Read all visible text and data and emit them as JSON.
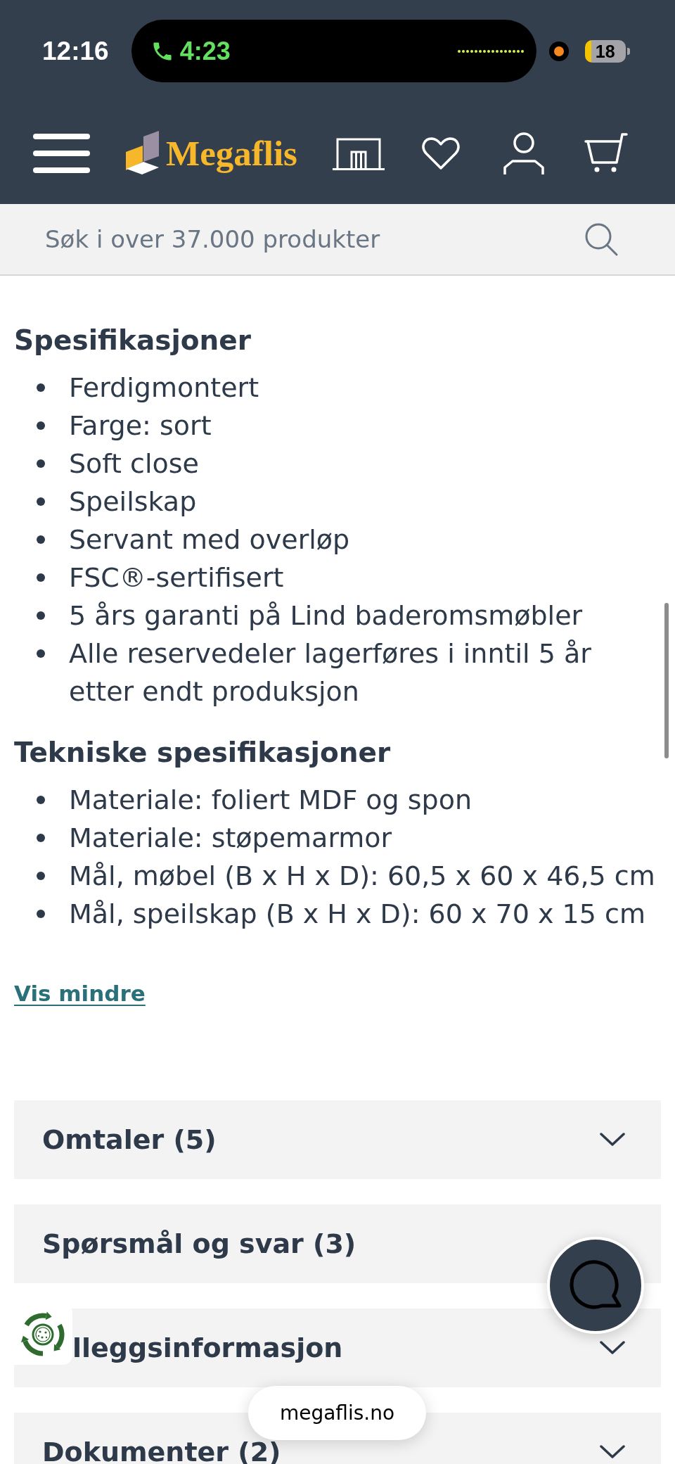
{
  "status_bar": {
    "time": "12:16",
    "call_timer": "4:23",
    "battery": "18"
  },
  "header": {
    "logo": "Megaflis"
  },
  "search": {
    "placeholder": "Søk i over 37.000 produkter"
  },
  "spec_groups": [
    {
      "title": "Spesifikasjoner",
      "items": [
        "Ferdigmontert",
        "Farge: sort",
        "Soft close",
        "Speilskap",
        "Servant med overløp",
        "FSC®-sertifisert",
        "5 års garanti på Lind baderomsmøbler",
        "Alle reservedeler lagerføres i inntil 5 år etter endt produksjon"
      ]
    },
    {
      "title": "Tekniske spesifikasjoner",
      "items": [
        "Materiale: foliert MDF og spon",
        "Materiale: støpemarmor",
        "Mål, møbel (B x H x D): 60,5 x 60 x 46,5 cm",
        "Mål, speilskap (B x H x D): 60 x 70 x 15 cm"
      ]
    }
  ],
  "show_less_link": "Vis mindre",
  "sections": [
    {
      "kind": "plain",
      "title": "Omtaler (5)",
      "expanded": false
    },
    {
      "kind": "plain",
      "title": "Spørsmål og svar (3)"
    },
    {
      "kind": "covered",
      "title": "lleggsinformasjon",
      "expanded": false
    },
    {
      "kind": "plain",
      "title": "Dokumenter (2)",
      "expanded": false
    }
  ],
  "address_bar": "megaflis.no"
}
